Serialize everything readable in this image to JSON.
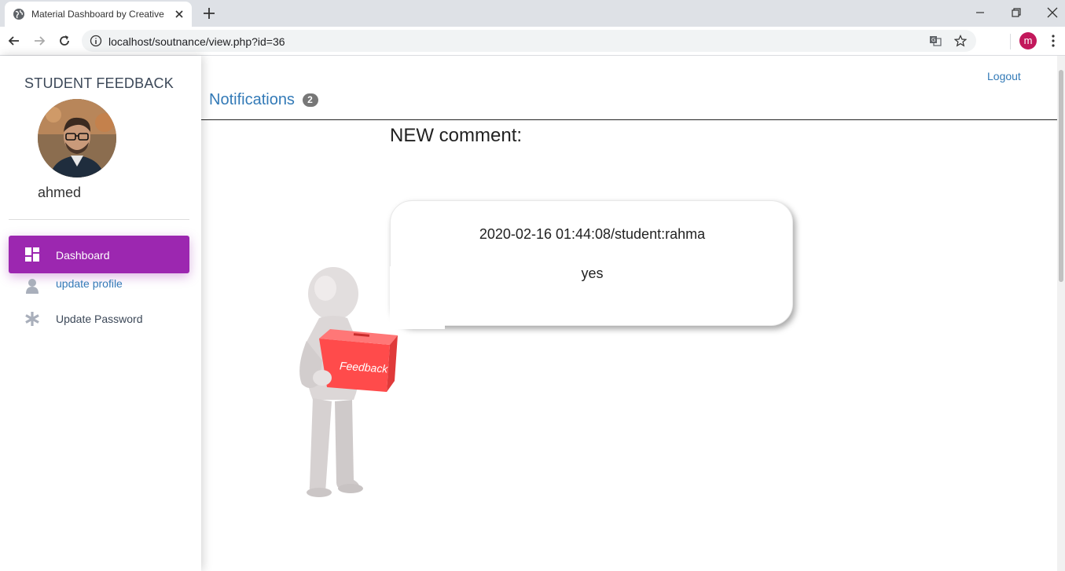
{
  "browser": {
    "tab_title": "Material Dashboard by Creative T",
    "url": "localhost/soutnance/view.php?id=36",
    "profile_initial": "m"
  },
  "sidebar": {
    "brand": "STUDENT FEEDBACK",
    "username": "ahmed",
    "items": [
      {
        "label": "Dashboard",
        "icon": "dashboard-icon",
        "active": true
      },
      {
        "label": "update profile",
        "icon": "person-icon",
        "active": false
      },
      {
        "label": "Update Password",
        "icon": "asterisk-icon",
        "active": false
      }
    ]
  },
  "header": {
    "logout_label": "Logout",
    "notifications_label": "Notifications",
    "notifications_count": "2"
  },
  "main": {
    "heading": "NEW comment:",
    "comment": {
      "meta": "2020-02-16 01:44:08/student:rahma",
      "body": "yes"
    },
    "illustration_text": "Feedback"
  },
  "colors": {
    "accent": "#9c27b0",
    "link": "#337ab7",
    "badge": "#777777",
    "feedback_box": "#ff4b4b"
  }
}
